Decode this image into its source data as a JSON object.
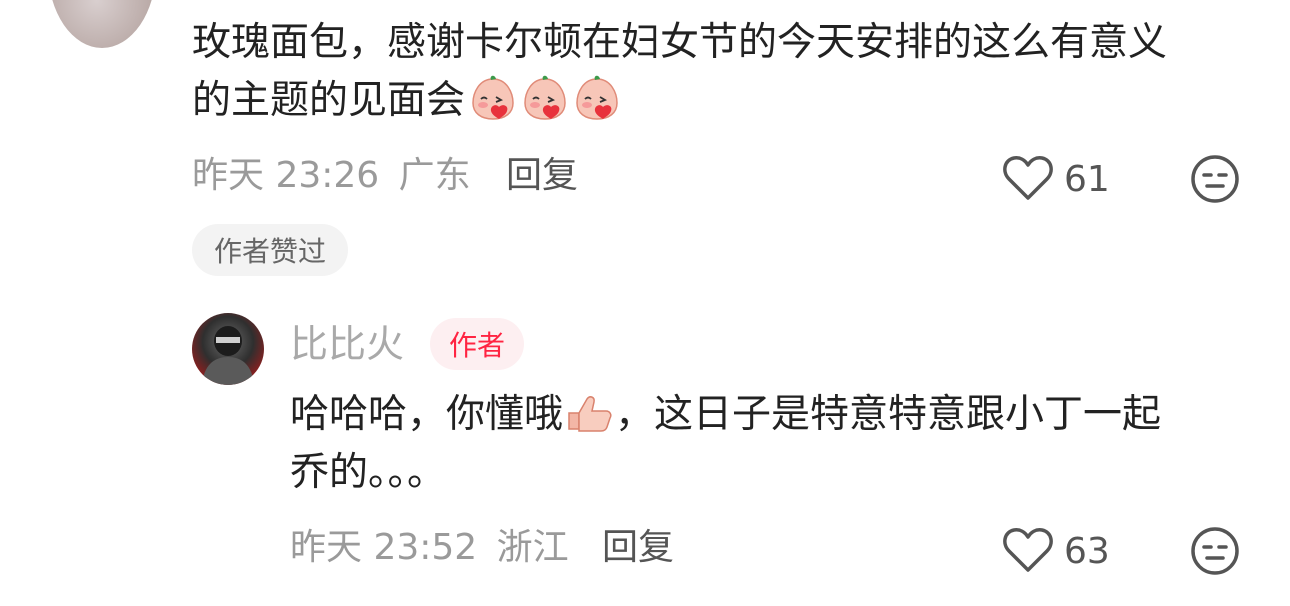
{
  "comment": {
    "text_line1": "玫瑰面包，感谢卡尔顿在妇女节的今天安排的这么有意义",
    "text_line2": "的主题的见面会",
    "time": "昨天 23:26",
    "location": "广东",
    "reply_label": "回复",
    "like_count": "61",
    "liked_by_author_label": "作者赞过",
    "icons": {
      "like": "heart-outline-icon",
      "dislike": "neutral-face-icon",
      "emoji": "blushing-face-emoji"
    }
  },
  "reply": {
    "author": "比比火",
    "author_badge": "作者",
    "text_part1": "哈哈哈，你懂哦",
    "text_part2": "，这日子是特意特意跟小丁一起",
    "text_line2": "乔的。。。",
    "time": "昨天 23:52",
    "location": "浙江",
    "reply_label": "回复",
    "like_count": "63",
    "icons": {
      "like": "heart-outline-icon",
      "dislike": "neutral-face-icon",
      "emoji": "thumbs-up-emoji"
    }
  },
  "colors": {
    "accent": "#ff2442",
    "meta": "#9a9a9a",
    "text": "#222222"
  }
}
